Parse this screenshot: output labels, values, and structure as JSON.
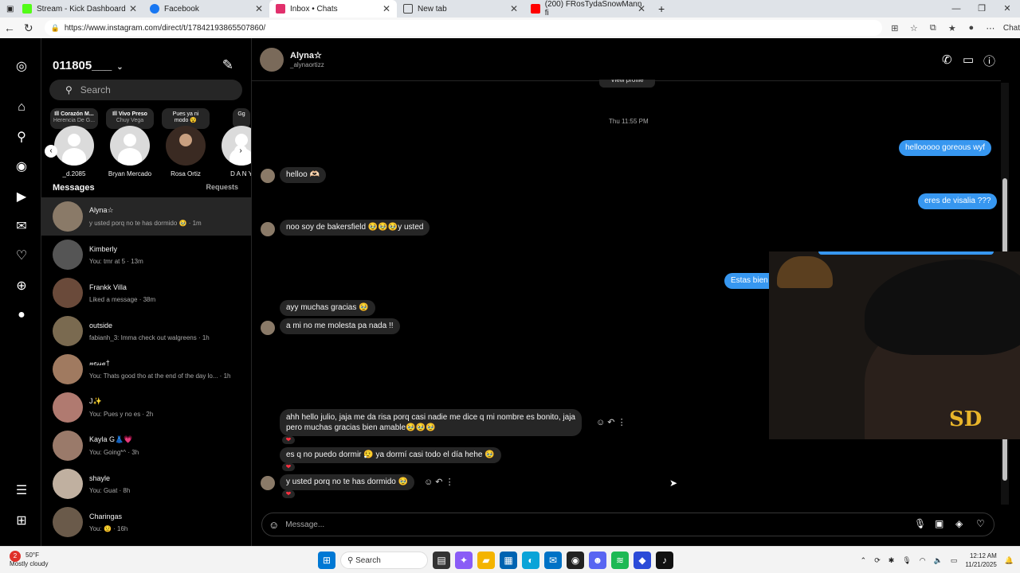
{
  "browser": {
    "tabs": [
      {
        "title": "Stream - Kick Dashboard",
        "color": "#53fc18"
      },
      {
        "title": "Facebook",
        "color": "#1877f2"
      },
      {
        "title": "Inbox • Chats",
        "color": "#e1306c"
      },
      {
        "title": "New tab",
        "color": "#444444"
      },
      {
        "title": "(200) FRosTydaSnowMann fi",
        "color": "#ff0000"
      }
    ],
    "url": "https://www.instagram.com/direct/t/17842193865507860/",
    "chat_label": "Chat"
  },
  "sidebar": {
    "account": "011805___",
    "search_placeholder": "Search",
    "stories": [
      {
        "note_title": "Ill Corazón M...",
        "note_sub": "Herencia De G...",
        "name": "_d.2085"
      },
      {
        "note_title": "Ill Vivo Preso",
        "note_sub": "Chuy Vega",
        "name": "Bryan Mercado"
      },
      {
        "note_title": "Pues ya ni",
        "note_sub": "modo 😵",
        "name": "Rosa Ortiz"
      },
      {
        "note_title": "Gg",
        "note_sub": "",
        "name": "D A N Y"
      }
    ],
    "messages_label": "Messages",
    "requests_label": "Requests",
    "conversations": [
      {
        "name": "Alyna☆",
        "preview": "y usted porq no te has dormido 🥹 · 1m",
        "color": "#8a7a68"
      },
      {
        "name": "Kimberly",
        "preview": "You: tmr at 5 · 13m",
        "color": "#555555"
      },
      {
        "name": "Frankk Villa",
        "preview": "Liked a message · 38m",
        "color": "#6a4a3a"
      },
      {
        "name": "outside",
        "preview": "fabianh_3: Imma check out walgreens · 1h",
        "color": "#7a6a50"
      },
      {
        "name": "𝓃𝑒𝓈𝓈𝒶†",
        "preview": "You: Thats good tho at the end of the day lo... · 1h",
        "color": "#a07a60"
      },
      {
        "name": "J✨",
        "preview": "You: Pues y no es · 2h",
        "color": "#b07a70"
      },
      {
        "name": "Kayla G👗💗",
        "preview": "You: Going*^ · 3h",
        "color": "#9a7a6a"
      },
      {
        "name": "shayle",
        "preview": "You: Guat · 8h",
        "color": "#c0b0a0"
      },
      {
        "name": "Charingas",
        "preview": "You: 😟 · 16h",
        "color": "#6a5a4a"
      }
    ]
  },
  "chat": {
    "name": "Alyna☆",
    "username": "_alynaortizz",
    "view_profile": "View profile",
    "timestamp": "Thu 11:55 PM",
    "messages": [
      {
        "from": "me",
        "text": "hellooooo goreous wyf"
      },
      {
        "from": "them",
        "text": "helloo 🫶🏻"
      },
      {
        "from": "me",
        "text": "eres de visalia ???"
      },
      {
        "from": "them",
        "text": "noo soy de bakersfield 🥹🥹🥹y usted"
      },
      {
        "from": "me",
        "text": "Estas bien"
      },
      {
        "from": "them",
        "text": "ayy muchas gracias 🥹"
      },
      {
        "from": "them",
        "text": "a mi no me molesta pa nada !!"
      },
      {
        "from": "them",
        "text": "ahh hello julio,  jaja me da risa porq casi nadie me dice q mi nombre es bonito, jaja"
      },
      {
        "from": "them",
        "text": "pero muchas gracias bien amable🥹🥹🥹"
      },
      {
        "from": "them",
        "text": "es q no puedo dormir 😮‍💨 ya dormí casi todo el día hehe 🥹"
      },
      {
        "from": "them",
        "text": "y usted porq no te has dormido 🥹"
      }
    ],
    "composer_placeholder": "Message..."
  },
  "taskbar": {
    "temp": "50°F",
    "weather": "Mostly cloudy",
    "search_label": "Search",
    "time": "12:12 AM",
    "date": "11/21/2025",
    "badge": "2"
  },
  "overlay": {
    "logo": "SD"
  }
}
